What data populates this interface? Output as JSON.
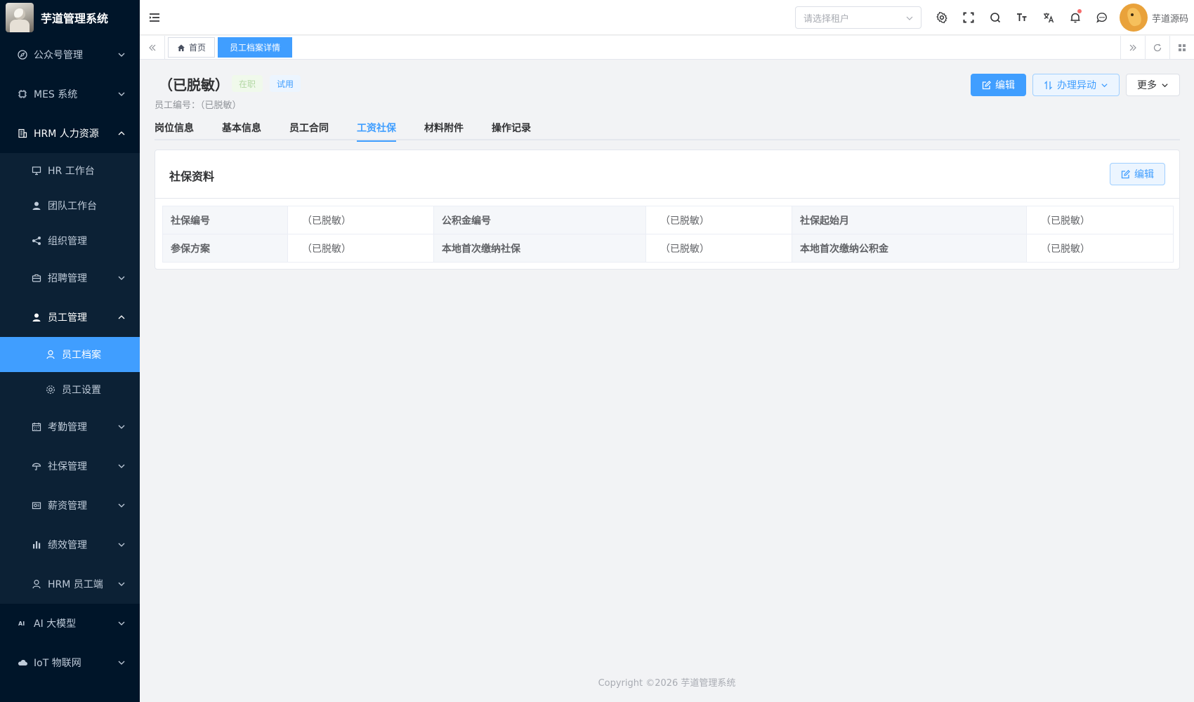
{
  "app": {
    "title": "芋道管理系统"
  },
  "sidebar": {
    "items": [
      {
        "label": "公众号管理",
        "icon": "compass-icon",
        "arrow": "down"
      },
      {
        "label": "MES 系统",
        "icon": "chip-icon",
        "arrow": "down"
      },
      {
        "label": "HRM 人力资源",
        "icon": "building-icon",
        "arrow": "up"
      }
    ],
    "hrm_children": [
      {
        "label": "HR 工作台",
        "icon": "monitor-icon"
      },
      {
        "label": "团队工作台",
        "icon": "user-icon"
      },
      {
        "label": "组织管理",
        "icon": "share-icon"
      },
      {
        "label": "招聘管理",
        "icon": "briefcase-icon",
        "arrow": "down"
      },
      {
        "label": "员工管理",
        "icon": "user-icon",
        "arrow": "up"
      }
    ],
    "employee_children": [
      {
        "label": "员工档案",
        "icon": "user-outline-icon",
        "active": true
      },
      {
        "label": "员工设置",
        "icon": "gear-icon"
      }
    ],
    "hrm_children_after": [
      {
        "label": "考勤管理",
        "icon": "calendar-icon",
        "arrow": "down"
      },
      {
        "label": "社保管理",
        "icon": "umbrella-icon",
        "arrow": "down"
      },
      {
        "label": "薪资管理",
        "icon": "wallet-icon",
        "arrow": "down"
      },
      {
        "label": "绩效管理",
        "icon": "bar-chart-icon",
        "arrow": "down"
      },
      {
        "label": "HRM 员工端",
        "icon": "user-outline-icon",
        "arrow": "down"
      }
    ],
    "items_after": [
      {
        "label": "AI 大模型",
        "icon": "ai-icon",
        "arrow": "down"
      },
      {
        "label": "IoT 物联网",
        "icon": "cloud-icon",
        "arrow": "down"
      }
    ]
  },
  "topbar": {
    "tenant_placeholder": "请选择租户",
    "username": "芋道源码"
  },
  "tags": {
    "home": "首页",
    "current": "员工档案详情"
  },
  "employee": {
    "name": "（已脱敏）",
    "status_tag": "在职",
    "type_tag": "试用",
    "code_label": "员工编号：（已脱敏）"
  },
  "actions": {
    "edit": "编辑",
    "change": "办理异动",
    "more": "更多"
  },
  "tabs": [
    "岗位信息",
    "基本信息",
    "员工合同",
    "工资社保",
    "材料附件",
    "操作记录"
  ],
  "active_tab": "工资社保",
  "card": {
    "title": "社保资料",
    "edit": "编辑",
    "rows": [
      [
        {
          "label": "社保编号",
          "value": "（已脱敏）"
        },
        {
          "label": "公积金编号",
          "value": "（已脱敏）"
        },
        {
          "label": "社保起始月",
          "value": "（已脱敏）"
        }
      ],
      [
        {
          "label": "参保方案",
          "value": "（已脱敏）"
        },
        {
          "label": "本地首次缴纳社保",
          "value": "（已脱敏）"
        },
        {
          "label": "本地首次缴纳公积金",
          "value": "（已脱敏）"
        }
      ]
    ]
  },
  "footer": {
    "copyright": "Copyright ©2026 芋道管理系统"
  },
  "colors": {
    "primary": "#409eff",
    "sidebar_bg": "#001529",
    "submenu_bg": "#0c2135"
  }
}
